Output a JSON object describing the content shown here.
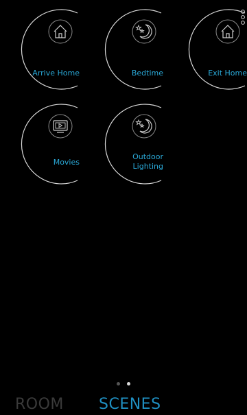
{
  "colors": {
    "background": "#000000",
    "ring": "#d9d9d9",
    "label": "#2aa9d8",
    "active_tab": "#1f8fc1",
    "inactive_tab": "#3a3a3a",
    "dot_active": "#d8d8d8",
    "dot_inactive": "#555555"
  },
  "scenes": [
    {
      "label": "Arrive Home",
      "icon": "house-icon"
    },
    {
      "label": "Bedtime",
      "icon": "moon-stars-icon"
    },
    {
      "label": "Exit Home",
      "icon": "house-icon"
    },
    {
      "label": "Movies",
      "icon": "tv-play-icon"
    },
    {
      "label_line1": "Outdoor",
      "label_line2": "Lighting",
      "icon": "moon-stars-icon"
    }
  ],
  "pager": {
    "pages": 2,
    "active_page": 2
  },
  "tabs": {
    "room": "ROOM",
    "scenes": "SCENES",
    "active": "SCENES"
  },
  "menu": {
    "icon": "overflow-menu-icon"
  }
}
